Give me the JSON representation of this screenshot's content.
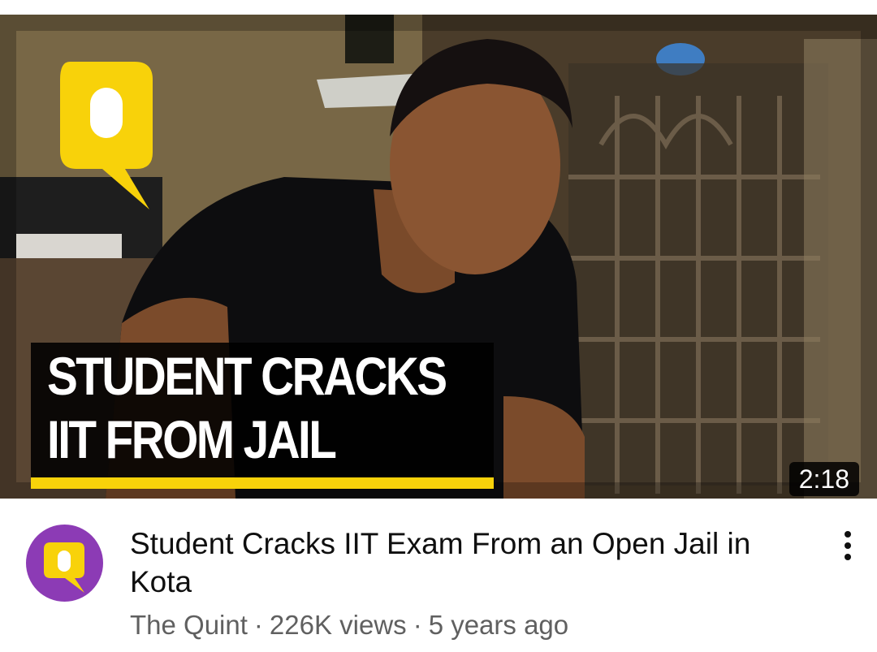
{
  "thumbnail": {
    "headline_line1": "STUDENT CRACKS",
    "headline_line2": "IIT FROM JAIL",
    "duration": "2:18",
    "logo_icon": "quint-logo-icon",
    "accent_color": "#f8d20a"
  },
  "video": {
    "title": "Student Cracks IIT Exam From an Open Jail in Kota",
    "channel": "The Quint",
    "views": "226K views",
    "age": "5 years ago",
    "separator": "·"
  },
  "channel_avatar": {
    "icon": "quint-logo-icon",
    "color": "#8c3bb5"
  },
  "more_button": {
    "icon": "more-vertical-icon"
  }
}
